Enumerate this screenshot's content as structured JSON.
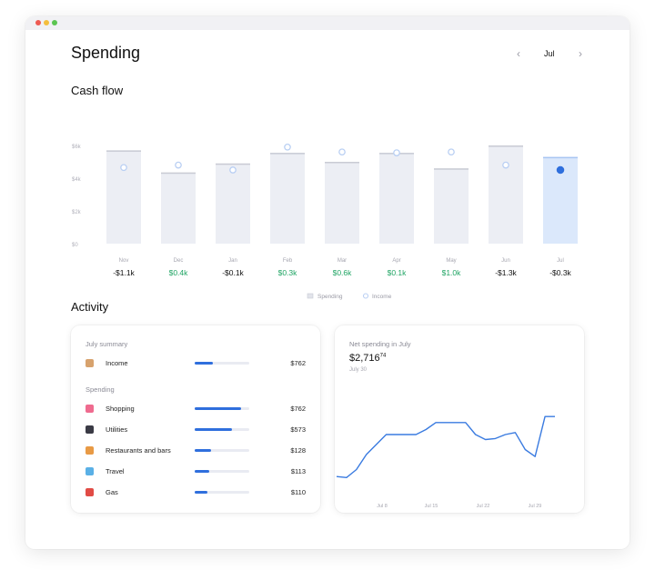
{
  "header": {
    "title": "Spending",
    "month_nav": {
      "prev_icon": "‹",
      "month": "Jul",
      "next_icon": "›"
    }
  },
  "cashflow": {
    "title": "Cash flow",
    "legend": {
      "spending": "Spending",
      "income": "Income"
    }
  },
  "chart_data": {
    "type": "bar",
    "title": "Cash flow",
    "categories": [
      "Nov",
      "Dec",
      "Jan",
      "Feb",
      "Mar",
      "Apr",
      "May",
      "Jun",
      "Jul"
    ],
    "y_ticks": [
      "$6k",
      "$4k",
      "$2k",
      "$0"
    ],
    "ylim": [
      0,
      6
    ],
    "series": [
      {
        "name": "Spending",
        "values": [
          5.7,
          4.35,
          4.9,
          5.55,
          5.0,
          5.55,
          4.6,
          6.0,
          5.3
        ]
      },
      {
        "name": "Income",
        "values": [
          4.65,
          4.8,
          4.5,
          5.9,
          5.6,
          5.55,
          5.6,
          4.8,
          4.5
        ]
      }
    ],
    "net_labels": [
      "-$1.1k",
      "$0.4k",
      "-$0.1k",
      "$0.3k",
      "$0.6k",
      "$0.1k",
      "$1.0k",
      "-$1.3k",
      "-$0.3k"
    ],
    "net_positive": [
      false,
      true,
      false,
      true,
      true,
      true,
      true,
      false,
      false
    ],
    "highlight_index": 8,
    "grid": false,
    "legend_position": "bottom-center",
    "colors": {
      "bar": "#eceef4",
      "bar_highlight": "#dbe8fb",
      "income_marker": "#b9cff3",
      "income_highlight": "#2f6fdd",
      "positive": "#1fa463",
      "negative": "#111111"
    }
  },
  "activity": {
    "title": "Activity",
    "summary": {
      "title": "July summary",
      "income": {
        "label": "Income",
        "amount": "$762",
        "fraction": 0.33,
        "icon": "money-bag-icon",
        "color": "#d7a26d"
      },
      "spending_header": "Spending",
      "items": [
        {
          "label": "Shopping",
          "amount": "$762",
          "fraction": 0.85,
          "icon": "shopping-icon",
          "color": "#ef6b8f"
        },
        {
          "label": "Utilities",
          "amount": "$573",
          "fraction": 0.68,
          "icon": "plug-icon",
          "color": "#3a3a45"
        },
        {
          "label": "Restaurants and bars",
          "amount": "$128",
          "fraction": 0.3,
          "icon": "food-icon",
          "color": "#e89a45"
        },
        {
          "label": "Travel",
          "amount": "$113",
          "fraction": 0.27,
          "icon": "travel-icon",
          "color": "#5ab0e6"
        },
        {
          "label": "Gas",
          "amount": "$110",
          "fraction": 0.23,
          "icon": "gas-icon",
          "color": "#e14b45"
        }
      ]
    },
    "net": {
      "title": "Net spending in July",
      "amount_main": "$2,716",
      "amount_cents": "74",
      "subtitle": "July 30",
      "x_ticks": [
        "Jul 8",
        "Jul 15",
        "Jul 22",
        "Jul 29"
      ],
      "line_color": "#3a7be0",
      "values": [
        0.18,
        0.17,
        0.25,
        0.4,
        0.5,
        0.6,
        0.6,
        0.6,
        0.6,
        0.65,
        0.72,
        0.72,
        0.72,
        0.72,
        0.6,
        0.55,
        0.56,
        0.6,
        0.62,
        0.45,
        0.38,
        0.78,
        0.78
      ]
    }
  }
}
